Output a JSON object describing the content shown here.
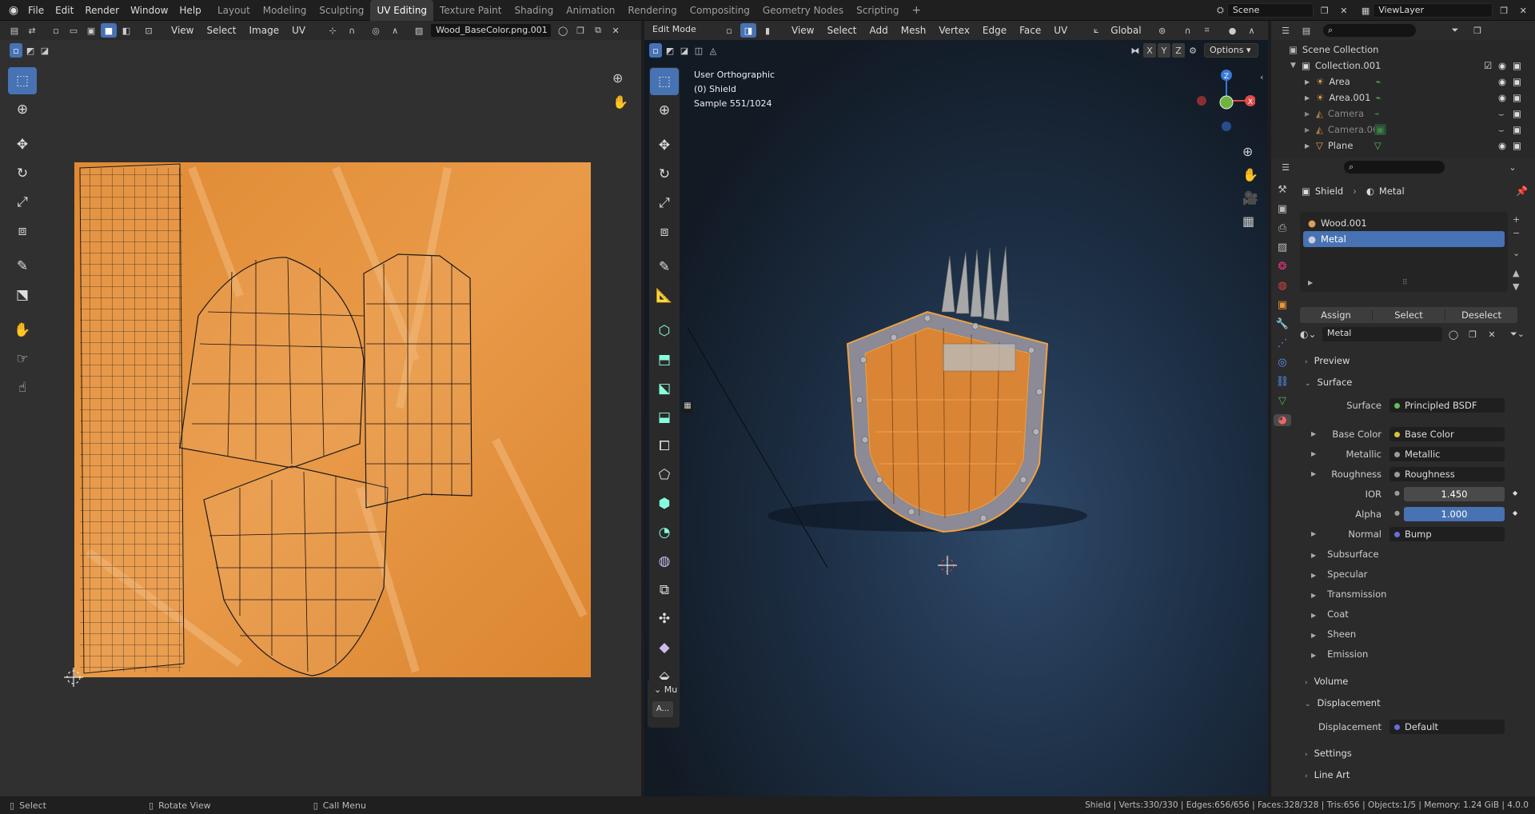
{
  "menu": {
    "file": "File",
    "edit": "Edit",
    "render": "Render",
    "window": "Window",
    "help": "Help"
  },
  "workspaces": [
    "Layout",
    "Modeling",
    "Sculpting",
    "UV Editing",
    "Texture Paint",
    "Shading",
    "Animation",
    "Rendering",
    "Compositing",
    "Geometry Nodes",
    "Scripting"
  ],
  "active_workspace": "UV Editing",
  "scene": "Scene",
  "view_layer": "ViewLayer",
  "uv_editor": {
    "menus": [
      "View",
      "Select",
      "Image",
      "UV"
    ],
    "image_name": "Wood_BaseColor.png.001"
  },
  "viewport": {
    "mode": "Edit Mode",
    "menus": [
      "View",
      "Select",
      "Add",
      "Mesh",
      "Vertex",
      "Edge",
      "Face",
      "UV"
    ],
    "transform_orientation": "Global",
    "options": "Options",
    "overlay_lines": [
      "User Orthographic",
      "(0) Shield",
      "Sample 551/1024"
    ],
    "axes": {
      "x": "X",
      "y": "Y",
      "z": "Z"
    },
    "op_panel_title": "Mu",
    "op_panel_btn": "A..."
  },
  "outliner": {
    "root": "Scene Collection",
    "collection": "Collection.001",
    "items": [
      {
        "name": "Area"
      },
      {
        "name": "Area.001"
      },
      {
        "name": "Camera"
      },
      {
        "name": "Camera.001"
      },
      {
        "name": "Plane"
      }
    ]
  },
  "properties": {
    "breadcrumb_object": "Shield",
    "breadcrumb_material": "Metal",
    "slots": [
      "Wood.001",
      "Metal"
    ],
    "active_slot": "Metal",
    "assign": "Assign",
    "select": "Select",
    "deselect": "Deselect",
    "material_name": "Metal",
    "preview": "Preview",
    "surface_section": "Surface",
    "surface_label": "Surface",
    "surface_value": "Principled BSDF",
    "base_color_label": "Base Color",
    "base_color_value": "Base Color",
    "metallic_label": "Metallic",
    "metallic_value": "Metallic",
    "roughness_label": "Roughness",
    "roughness_value": "Roughness",
    "ior_label": "IOR",
    "ior_value": "1.450",
    "alpha_label": "Alpha",
    "alpha_value": "1.000",
    "normal_label": "Normal",
    "normal_value": "Bump",
    "subsections": [
      "Subsurface",
      "Specular",
      "Transmission",
      "Coat",
      "Sheen",
      "Emission"
    ],
    "volume": "Volume",
    "displacement_section": "Displacement",
    "displacement_label": "Displacement",
    "displacement_value": "Default",
    "settings": "Settings",
    "line_art": "Line Art"
  },
  "status": {
    "select": "Select",
    "rotate": "Rotate View",
    "call_menu": "Call Menu",
    "stats": "Shield | Verts:330/330 | Edges:656/656 | Faces:328/328 | Tris:656 | Objects:1/5 | Memory: 1.24 GiB | 4.0.0"
  },
  "colors": {
    "accent": "#4772b3",
    "texture": "#e58f37",
    "selection": "#f0a040"
  }
}
